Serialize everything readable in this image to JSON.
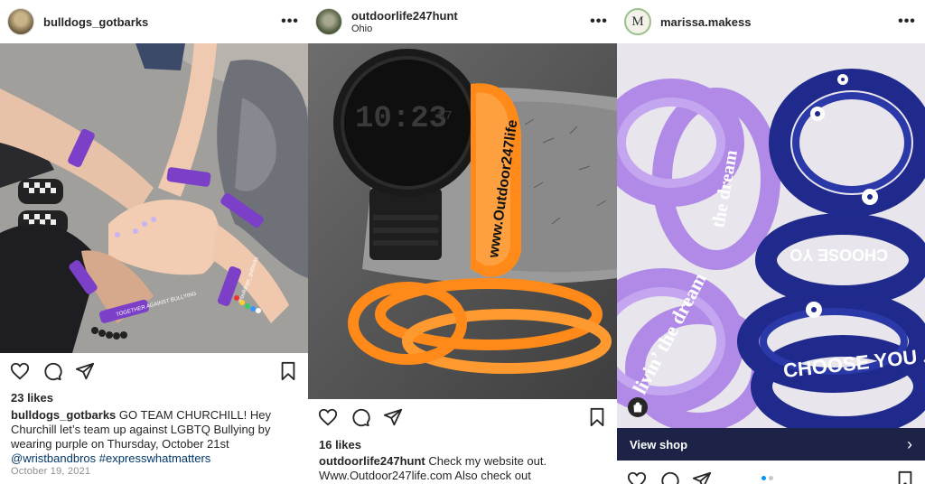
{
  "posts": [
    {
      "username": "bulldogs_gotbarks",
      "location": "",
      "more_glyph": "•••",
      "photo_text": {
        "band_1": "TOGETHER AGAINST BULLYING",
        "band_2": "@bulldogs_gotbarks"
      },
      "likes": "23 likes",
      "caption_user": "bulldogs_gotbarks",
      "caption_text": " GO TEAM CHURCHILL! Hey Churchill let’s team up against LGBTQ Bullying by wearing purple on Thursday, October 21st ",
      "caption_tags": "@wristbandbros #expresswhatmatters",
      "date": "October 19, 2021",
      "icons": [
        "heart-icon",
        "comment-icon",
        "share-icon",
        "bookmark-icon"
      ]
    },
    {
      "username": "outdoorlife247hunt",
      "location": "Ohio",
      "more_glyph": "•••",
      "photo_text": {
        "watch_time": "10:23",
        "watch_seconds": "37",
        "band_text": "www.Outdoor247life"
      },
      "likes": "16 likes",
      "caption_user": "outdoorlife247hunt",
      "caption_text": " Check my website out. Www.Outdoor247life.com  Also check out",
      "icons": [
        "heart-icon",
        "comment-icon",
        "share-icon",
        "bookmark-icon"
      ]
    },
    {
      "username": "marissa.makess",
      "avatar_letter": "M",
      "location": "",
      "more_glyph": "•••",
      "photo_text": {
        "band_a": "livin’ the dream",
        "band_b": "the dream",
        "band_c": "CHOOSE YO",
        "band_d": "CHOOSE YOU"
      },
      "view_shop": "View shop",
      "view_shop_chevron": "›",
      "icons": [
        "heart-icon",
        "comment-icon",
        "share-icon",
        "bookmark-icon",
        "shopping-bag-icon"
      ]
    }
  ],
  "colors": {
    "instagram_text": "#262626",
    "link": "#00376b",
    "muted": "#8e8e8e",
    "view_shop_bg": "#1c2347",
    "carousel_active": "#0095f6",
    "purple_band": "#8a4fd1",
    "orange_band": "#ff8a1a",
    "navy_band": "#1f2a8c",
    "lavender_band": "#b08ae6"
  }
}
